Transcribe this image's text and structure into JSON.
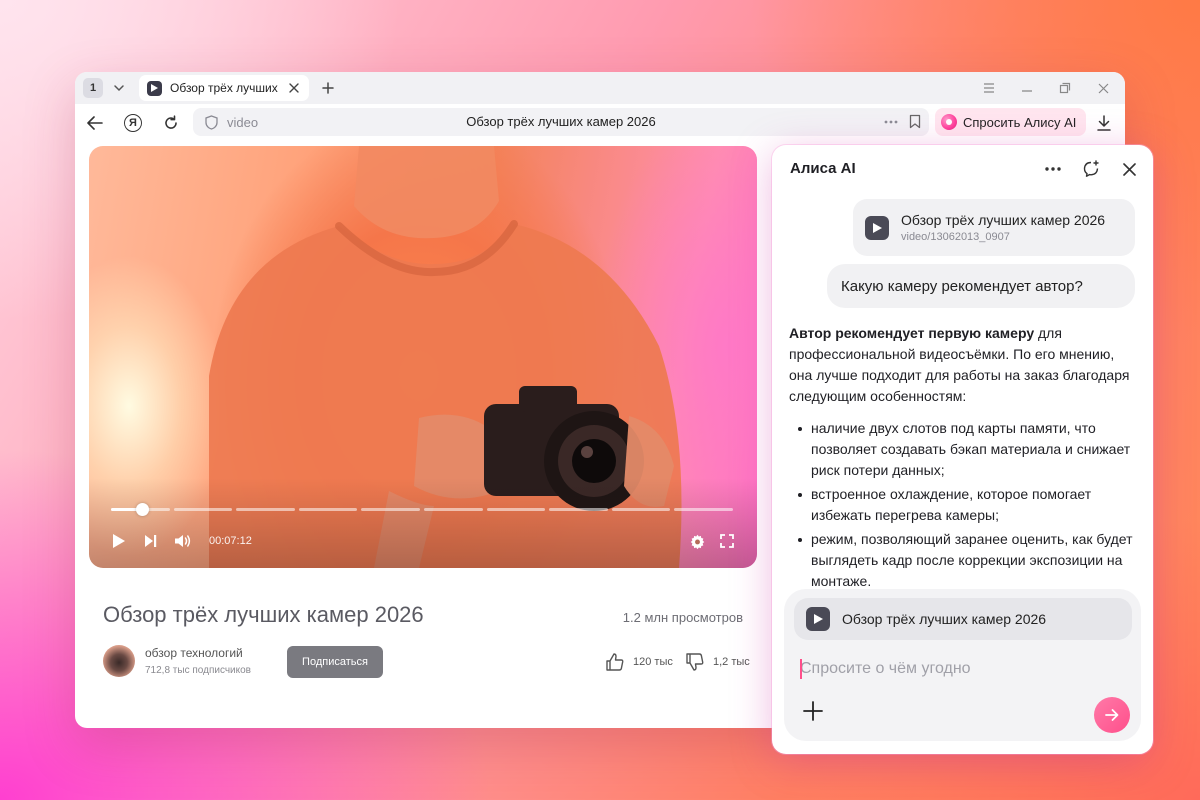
{
  "tabbar": {
    "tab_count": "1",
    "tab_title": "Обзор трёх лучших"
  },
  "toolbar": {
    "address_domain": "video",
    "address_title": "Обзор трёх лучших камер 2026",
    "ask_alice_label": "Спросить Алису AI"
  },
  "player": {
    "time": "00:07:12",
    "progress": 0.05,
    "segments": 10
  },
  "video": {
    "title": "Обзор трёх лучших камер 2026",
    "views": "1.2 млн просмотров",
    "channel_name": "обзор технологий",
    "subscribers": "712,8 тыс подписчиков",
    "subscribe_label": "Подписаться",
    "likes": "120 тыс",
    "dislikes": "1,2 тыс"
  },
  "alice": {
    "title": "Алиса AI",
    "source_title": "Обзор трёх лучших камер 2026",
    "source_subtitle": "video/13062013_0907",
    "user_question": "Какую камеру рекомендует автор?",
    "answer_bold": "Автор рекомендует первую камеру",
    "answer_intro": " для профессиональной видеосъёмки. По его мнению, она лучше подходит для работы на заказ благодаря следующим особенностям:",
    "answer_points": [
      "наличие двух слотов под карты памяти, что позволяет создавать бэкап материала и снижает риск потери данных;",
      "встроенное охлаждение, которое помогает избежать перегрева камеры;",
      "режим, позволяющий заранее оценить, как будет выглядеть кадр после коррекции экспозиции на монтаже."
    ],
    "composer_chip_title": "Обзор трёх лучших камер 2026",
    "composer_placeholder": "Спросите о чём угодно"
  },
  "colors": {
    "accent": "#ff4f8b",
    "subscribe_bg": "#7a7a80",
    "panel_bubble": "#f1f1f3"
  }
}
